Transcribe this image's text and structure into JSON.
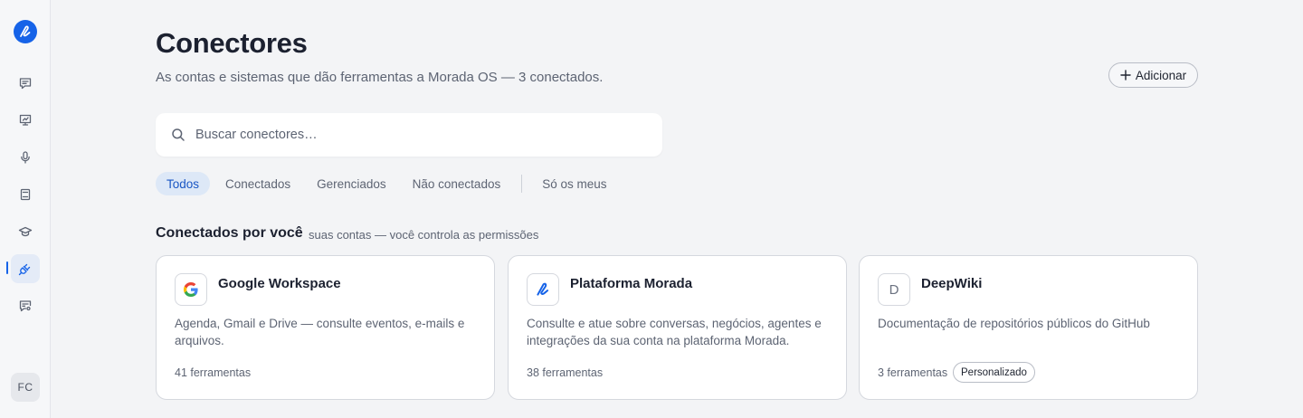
{
  "colors": {
    "accent": "#1663e8",
    "background": "#f3f4f6",
    "card_border": "#d5d8de",
    "active_chip_bg": "#dde8f7"
  },
  "sidebar": {
    "logo_icon": "morada-logo-icon",
    "items": [
      {
        "icon": "chat-icon",
        "active": false
      },
      {
        "icon": "presentation-icon",
        "active": false
      },
      {
        "icon": "microphone-icon",
        "active": false
      },
      {
        "icon": "book-icon",
        "active": false
      },
      {
        "icon": "graduation-cap-icon",
        "active": false
      },
      {
        "icon": "plug-icon",
        "active": true
      },
      {
        "icon": "chat-settings-icon",
        "active": false
      }
    ],
    "avatar_initials": "FC"
  },
  "header": {
    "title": "Conectores",
    "subtitle": "As contas e sistemas que dão ferramentas a Morada OS — 3 conectados.",
    "add_button_label": "Adicionar"
  },
  "search": {
    "placeholder": "Buscar conectores…",
    "value": ""
  },
  "filters": {
    "items": [
      "Todos",
      "Conectados",
      "Gerenciados",
      "Não conectados"
    ],
    "active": "Todos",
    "mine": "Só os meus"
  },
  "section": {
    "title": "Conectados por você",
    "subtitle": "suas contas — você controla as permissões"
  },
  "cards": [
    {
      "icon": "google-icon",
      "name": "Google Workspace",
      "description": "Agenda, Gmail e Drive — consulte eventos, e-mails e arquivos.",
      "tools": "41 ferramentas",
      "badge": ""
    },
    {
      "icon": "morada-logo-icon",
      "name": "Plataforma Morada",
      "description": "Consulte e atue sobre conversas, negócios, agentes e integrações da sua conta na plataforma Morada.",
      "tools": "38 ferramentas",
      "badge": ""
    },
    {
      "icon": "letter-d-icon",
      "icon_letter": "D",
      "name": "DeepWiki",
      "description": "Documentação de repositórios públicos do GitHub",
      "tools": "3 ferramentas",
      "badge": "Personalizado"
    }
  ]
}
